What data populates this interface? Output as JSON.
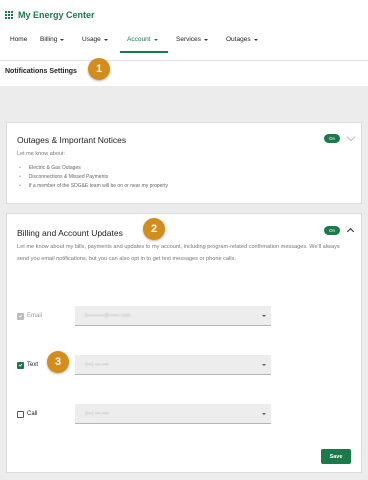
{
  "brand": {
    "title": "My Energy Center",
    "icon": "grid-icon",
    "color": "#1a7a4c"
  },
  "nav": {
    "items": [
      {
        "label": "Home",
        "has_caret": false
      },
      {
        "label": "Billing",
        "has_caret": true
      },
      {
        "label": "Usage",
        "has_caret": true
      },
      {
        "label": "Account",
        "has_caret": true,
        "active": true
      },
      {
        "label": "Services",
        "has_caret": true
      },
      {
        "label": "Outages",
        "has_caret": true
      }
    ]
  },
  "page": {
    "title": "Notifications Settings"
  },
  "markers": [
    "1",
    "2",
    "3"
  ],
  "outages_card": {
    "title": "Outages & Important Notices",
    "toggle": "On",
    "subtitle": "Let me know about:",
    "bullets": [
      "Electric & Gas Outages",
      "Disconnections & Missed Payments",
      "If a member of the SDG&E team will be on or near my property"
    ]
  },
  "billing_card": {
    "title": "Billing and Account Updates",
    "toggle": "On",
    "description": "Let me know about my bills, payments and updates to my account, including program-related confirmation messages. We'll always send you email notifications, but you can also opt in to get text messages or phone calls.",
    "options": [
      {
        "label": "Email",
        "checked": true,
        "disabled": true,
        "value": "f••••••••••@••••••.com"
      },
      {
        "label": "Text",
        "checked": true,
        "disabled": false,
        "value": "(•••) •••-••••"
      },
      {
        "label": "Call",
        "checked": false,
        "disabled": false,
        "value": "(•••) •••-••••"
      }
    ],
    "save_label": "Save"
  },
  "colors": {
    "accent": "#1a7a4c",
    "marker": "#d48d1a",
    "background": "#ececec"
  }
}
